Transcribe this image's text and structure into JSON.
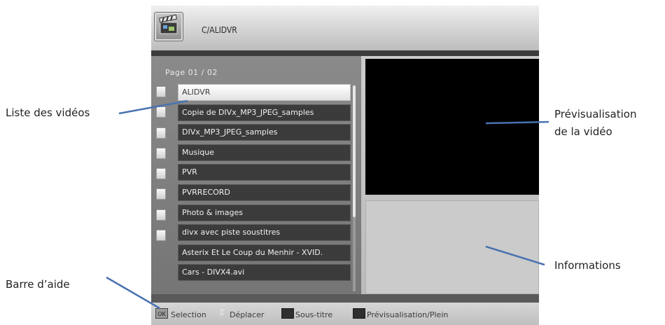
{
  "header": {
    "path": "C/ALIDVR",
    "app_icon": "film-clapper-icon"
  },
  "list": {
    "page_label": "Page  01 / 02",
    "items": [
      {
        "label": "ALIDVR",
        "type": "folder",
        "selected": true
      },
      {
        "label": "Copie de DIVx_MP3_JPEG_samples",
        "type": "folder"
      },
      {
        "label": "DIVx_MP3_JPEG_samples",
        "type": "folder"
      },
      {
        "label": "Musique",
        "type": "folder"
      },
      {
        "label": "PVR",
        "type": "folder"
      },
      {
        "label": "PVRRECORD",
        "type": "folder"
      },
      {
        "label": "Photo & images",
        "type": "folder"
      },
      {
        "label": "divx avec piste soustitres",
        "type": "folder"
      },
      {
        "label": "Asterix Et Le Coup du Menhir - XVID.",
        "type": "file"
      },
      {
        "label": "Cars - DIVX4.avi",
        "type": "file"
      }
    ]
  },
  "help_bar": {
    "ok_key": "OK",
    "selection": "Selection",
    "move": "Déplacer",
    "subtitle": "Sous-titre",
    "preview": "Prévisualisation/Plein"
  },
  "callouts": {
    "video_list": "Liste des vidéos",
    "help_bar": "Barre d’aide",
    "preview_line1": "Prévisualisation",
    "preview_line2": "de la vidéo",
    "info": "Informations"
  },
  "colors": {
    "callout_line": "#4a72b0",
    "selected_row": "#ffffff",
    "row": "#3b3b3b"
  }
}
